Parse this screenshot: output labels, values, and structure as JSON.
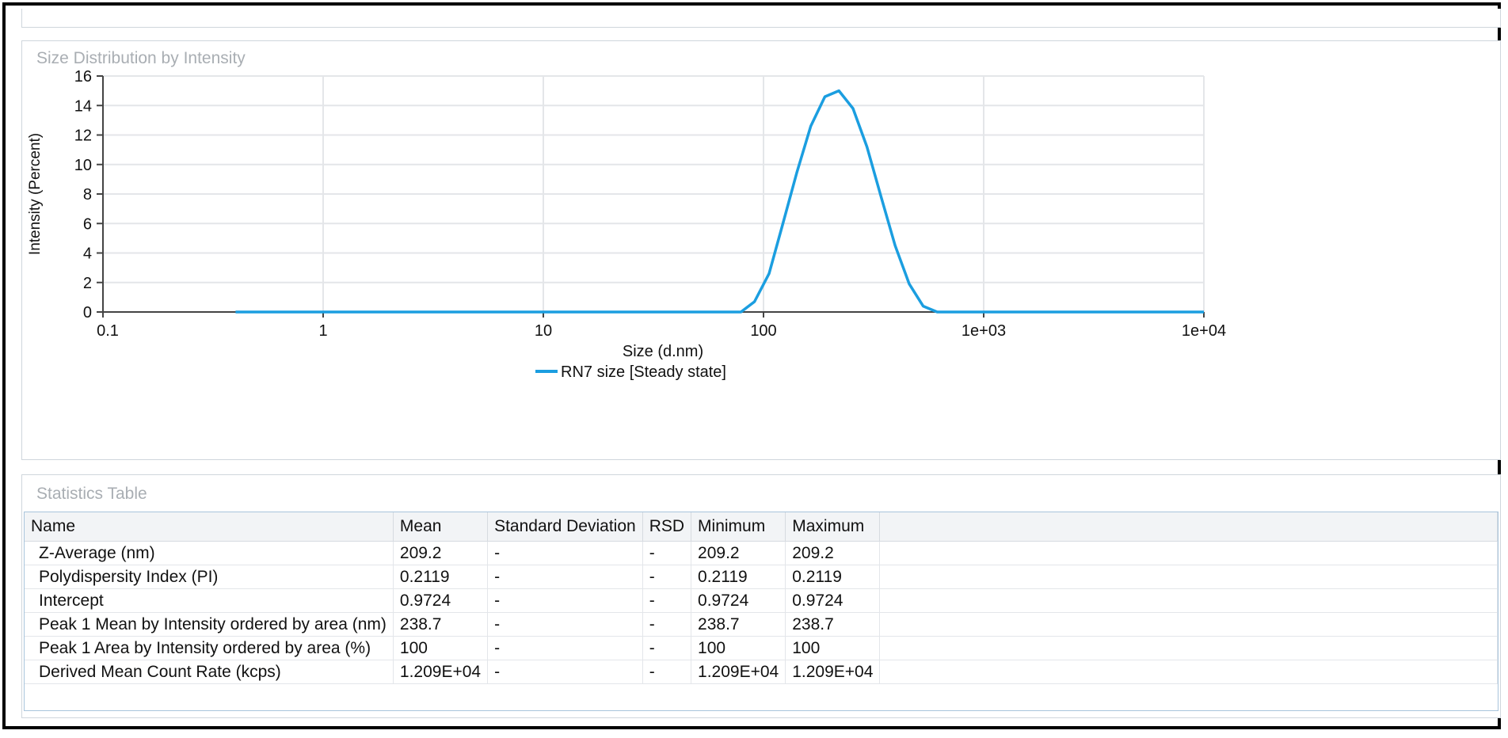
{
  "chart_panel": {
    "title": "Size Distribution by Intensity"
  },
  "chart_data": {
    "type": "line",
    "title": "",
    "xlabel": "Size (d.nm)",
    "ylabel": "Intensity (Percent)",
    "xscale": "log",
    "xlim": [
      0.1,
      10000
    ],
    "ylim": [
      0,
      16
    ],
    "x_ticks": [
      "0.1",
      "1",
      "10",
      "100",
      "1e+03",
      "1e+04"
    ],
    "y_ticks": [
      "0",
      "2",
      "4",
      "6",
      "8",
      "10",
      "12",
      "14",
      "16"
    ],
    "grid": true,
    "legend_position": "bottom-center",
    "series": [
      {
        "name": "RN7 size [Steady state]",
        "color": "#1b9ee0",
        "x": [
          0.4,
          1,
          10,
          50,
          79,
          91,
          106,
          122,
          142,
          164,
          190,
          220,
          255,
          295,
          342,
          396,
          459,
          531,
          615,
          712,
          1000,
          10000
        ],
        "y": [
          0,
          0,
          0,
          0,
          0,
          0.7,
          2.6,
          5.9,
          9.5,
          12.6,
          14.6,
          15.0,
          13.8,
          11.2,
          7.8,
          4.5,
          1.9,
          0.4,
          0,
          0,
          0,
          0
        ]
      }
    ]
  },
  "stats_panel": {
    "title": "Statistics Table",
    "columns": [
      "Name",
      "Mean",
      "Standard Deviation",
      "RSD",
      "Minimum",
      "Maximum"
    ],
    "rows": [
      [
        "Z-Average (nm)",
        "209.2",
        "-",
        "-",
        "209.2",
        "209.2"
      ],
      [
        "Polydispersity Index (PI)",
        "0.2119",
        "-",
        "-",
        "0.2119",
        "0.2119"
      ],
      [
        "Intercept",
        "0.9724",
        "-",
        "-",
        "0.9724",
        "0.9724"
      ],
      [
        "Peak 1 Mean by Intensity ordered by area (nm)",
        "238.7",
        "-",
        "-",
        "238.7",
        "238.7"
      ],
      [
        "Peak 1 Area by Intensity ordered by area (%)",
        "100",
        "-",
        "-",
        "100",
        "100"
      ],
      [
        "Derived Mean Count Rate (kcps)",
        "1.209E+04",
        "-",
        "-",
        "1.209E+04",
        "1.209E+04"
      ]
    ]
  }
}
